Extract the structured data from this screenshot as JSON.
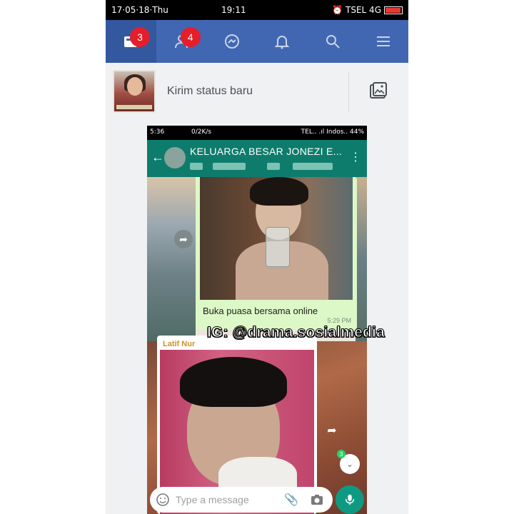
{
  "status_bar": {
    "date": "17·05·18·Thu",
    "time": "19:11",
    "carrier": "TSEL 4G"
  },
  "fb_nav": {
    "items": [
      {
        "icon": "news-feed-icon",
        "badge": "3",
        "active": true
      },
      {
        "icon": "friend-requests-icon",
        "badge": "4",
        "active": false
      },
      {
        "icon": "messenger-icon",
        "badge": "",
        "active": false
      },
      {
        "icon": "notifications-bell-icon",
        "badge": "",
        "active": false
      },
      {
        "icon": "search-icon",
        "badge": "",
        "active": false
      },
      {
        "icon": "menu-icon",
        "badge": "",
        "active": false
      }
    ],
    "color": "#4267b2"
  },
  "composer": {
    "placeholder": "Kirim status baru"
  },
  "shared_screenshot": {
    "status_left": "5:36",
    "speed": "0/2K/s",
    "status_right": "TEL.. .ıl Indos.. 44%",
    "group_title": "KELUARGA BESAR JONEZI E...",
    "header_color": "#0e7c6c",
    "message_1": {
      "caption": "Buka puasa bersama online",
      "time": "5:29 PM"
    },
    "message_2": {
      "sender": "Latif Nur"
    },
    "unread_count": "3",
    "input_placeholder": "Type a message"
  },
  "watermark": "IG: @drama.sosialmedia"
}
